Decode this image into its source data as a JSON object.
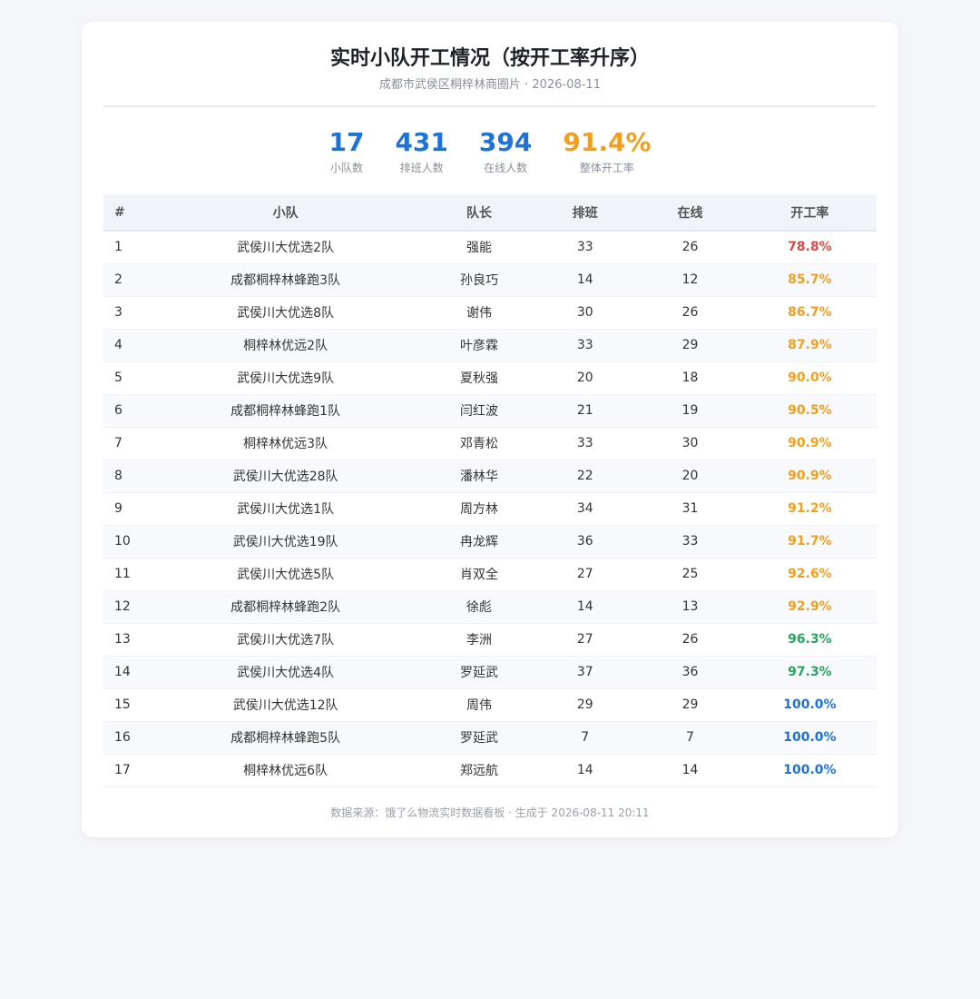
{
  "header": {
    "title": "实时小队开工情况（按开工率升序）",
    "subtitle": "成都市武侯区桐梓林商圈片 · 2026-08-11"
  },
  "stats": [
    {
      "value": "17",
      "label": "小队数",
      "color": "#1e73d8"
    },
    {
      "value": "431",
      "label": "排班人数",
      "color": "#1e73d8"
    },
    {
      "value": "394",
      "label": "在线人数",
      "color": "#1e73d8"
    },
    {
      "value": "91.4%",
      "label": "整体开工率",
      "color": "#f0a020"
    }
  ],
  "colors": {
    "low": "#e04848",
    "mid": "#f0a020",
    "high": "#28a55f",
    "full": "#1e73d8"
  },
  "table": {
    "headers": [
      "#",
      "小队",
      "队长",
      "排班",
      "在线",
      "开工率"
    ],
    "rows": [
      {
        "idx": "1",
        "team": "武侯川大优选2队",
        "leader": "强能",
        "scheduled": "33",
        "online": "26",
        "rate": "78.8%",
        "level": "low"
      },
      {
        "idx": "2",
        "team": "成都桐梓林蜂跑3队",
        "leader": "孙良巧",
        "scheduled": "14",
        "online": "12",
        "rate": "85.7%",
        "level": "mid"
      },
      {
        "idx": "3",
        "team": "武侯川大优选8队",
        "leader": "谢伟",
        "scheduled": "30",
        "online": "26",
        "rate": "86.7%",
        "level": "mid"
      },
      {
        "idx": "4",
        "team": "桐梓林优远2队",
        "leader": "叶彦霖",
        "scheduled": "33",
        "online": "29",
        "rate": "87.9%",
        "level": "mid"
      },
      {
        "idx": "5",
        "team": "武侯川大优选9队",
        "leader": "夏秋强",
        "scheduled": "20",
        "online": "18",
        "rate": "90.0%",
        "level": "mid"
      },
      {
        "idx": "6",
        "team": "成都桐梓林蜂跑1队",
        "leader": "闫红波",
        "scheduled": "21",
        "online": "19",
        "rate": "90.5%",
        "level": "mid"
      },
      {
        "idx": "7",
        "team": "桐梓林优远3队",
        "leader": "邓青松",
        "scheduled": "33",
        "online": "30",
        "rate": "90.9%",
        "level": "mid"
      },
      {
        "idx": "8",
        "team": "武侯川大优选28队",
        "leader": "潘林华",
        "scheduled": "22",
        "online": "20",
        "rate": "90.9%",
        "level": "mid"
      },
      {
        "idx": "9",
        "team": "武侯川大优选1队",
        "leader": "周方林",
        "scheduled": "34",
        "online": "31",
        "rate": "91.2%",
        "level": "mid"
      },
      {
        "idx": "10",
        "team": "武侯川大优选19队",
        "leader": "冉龙辉",
        "scheduled": "36",
        "online": "33",
        "rate": "91.7%",
        "level": "mid"
      },
      {
        "idx": "11",
        "team": "武侯川大优选5队",
        "leader": "肖双全",
        "scheduled": "27",
        "online": "25",
        "rate": "92.6%",
        "level": "mid"
      },
      {
        "idx": "12",
        "team": "成都桐梓林蜂跑2队",
        "leader": "徐彪",
        "scheduled": "14",
        "online": "13",
        "rate": "92.9%",
        "level": "mid"
      },
      {
        "idx": "13",
        "team": "武侯川大优选7队",
        "leader": "李洲",
        "scheduled": "27",
        "online": "26",
        "rate": "96.3%",
        "level": "high"
      },
      {
        "idx": "14",
        "team": "武侯川大优选4队",
        "leader": "罗延武",
        "scheduled": "37",
        "online": "36",
        "rate": "97.3%",
        "level": "high"
      },
      {
        "idx": "15",
        "team": "武侯川大优选12队",
        "leader": "周伟",
        "scheduled": "29",
        "online": "29",
        "rate": "100.0%",
        "level": "full"
      },
      {
        "idx": "16",
        "team": "成都桐梓林蜂跑5队",
        "leader": "罗延武",
        "scheduled": "7",
        "online": "7",
        "rate": "100.0%",
        "level": "full"
      },
      {
        "idx": "17",
        "team": "桐梓林优远6队",
        "leader": "郑远航",
        "scheduled": "14",
        "online": "14",
        "rate": "100.0%",
        "level": "full"
      }
    ]
  },
  "footer": {
    "text": "数据来源：饿了么物流实时数据看板 · 生成于 2026-08-11 20:11"
  }
}
